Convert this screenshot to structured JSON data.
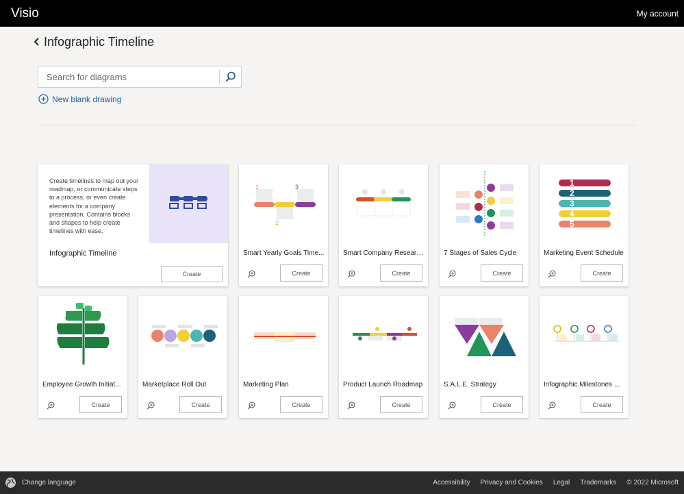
{
  "app": {
    "name": "Visio",
    "account_label": "My account"
  },
  "page": {
    "title": "Infographic Timeline"
  },
  "search": {
    "placeholder": "Search for diagrams"
  },
  "new_blank": {
    "label": "New blank drawing"
  },
  "featured": {
    "title": "Infographic Timeline",
    "description": "Create timelines to map out your roadmap, or communicate steps to a process, or even create elements for a company presentation. Contains blocks and shapes to help create timelines with ease.",
    "create_label": "Create"
  },
  "cards": [
    {
      "title": "Smart Yearly Goals Time...",
      "create_label": "Create",
      "markers": [
        "1",
        "2",
        "3"
      ]
    },
    {
      "title": "Smart Company Researc...",
      "create_label": "Create"
    },
    {
      "title": "7 Stages of Sales Cycle",
      "create_label": "Create"
    },
    {
      "title": "Marketing Event Schedule",
      "create_label": "Create",
      "markers": [
        "1",
        "2",
        "3",
        "4",
        "5"
      ]
    },
    {
      "title": "Employee Growth Initiat...",
      "create_label": "Create"
    },
    {
      "title": "Marketplace Roll Out",
      "create_label": "Create"
    },
    {
      "title": "Marketing Plan",
      "create_label": "Create"
    },
    {
      "title": "Product Launch Roadmap",
      "create_label": "Create"
    },
    {
      "title": "S.A.L.E. Strategy",
      "create_label": "Create"
    },
    {
      "title": "Infographic Milestones ...",
      "create_label": "Create"
    }
  ],
  "footer": {
    "change_language": "Change language",
    "links": [
      "Accessibility",
      "Privacy and Cookies",
      "Legal",
      "Trademarks"
    ],
    "copyright": "© 2022 Microsoft"
  },
  "colors": {
    "topbar": "#000000",
    "footer": "#2b2b2b",
    "link": "#1f5fa8",
    "featured_thumb_bg": "#e8e3f8",
    "template_navy": "#2f4aa8",
    "palette": [
      "#e9836a",
      "#f2cf3a",
      "#8e3b9f",
      "#d94f2b",
      "#22945a",
      "#2b7bc4",
      "#b22b4f",
      "#1d6278",
      "#48b6b4"
    ]
  },
  "icons": [
    "back-chevron-icon",
    "search-icon",
    "plus-circle-icon",
    "zoom-icon",
    "globe-icon"
  ]
}
